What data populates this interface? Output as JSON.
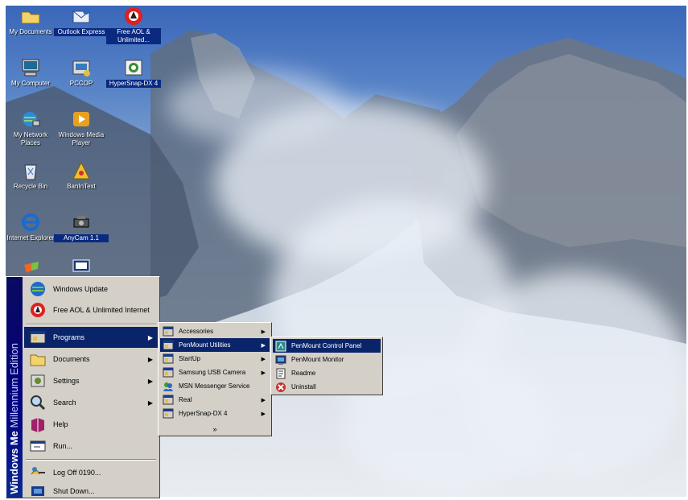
{
  "desktop": {
    "icons": [
      {
        "label": "My Documents",
        "icon": "folder-icon"
      },
      {
        "label": "Outlook Express",
        "icon": "outlook-express-icon"
      },
      {
        "label": "Free AOL & Unlimited...",
        "icon": "aol-icon"
      },
      {
        "label": "My Computer",
        "icon": "computer-icon"
      },
      {
        "label": "PCCOP",
        "icon": "pccop-icon"
      },
      {
        "label": "HyperSnap-DX 4",
        "icon": "hypersnap-icon"
      },
      {
        "label": "My Network Places",
        "icon": "network-icon"
      },
      {
        "label": "Windows Media Player",
        "icon": "media-player-icon"
      },
      {
        "label": "Recycle Bin",
        "icon": "recycle-bin-icon"
      },
      {
        "label": "BanInText",
        "icon": "bantext-icon"
      },
      {
        "label": "Internet Explorer",
        "icon": "internet-explorer-icon"
      },
      {
        "label": "AnyCam 1.1",
        "icon": "camera-icon"
      }
    ]
  },
  "start_menu": {
    "sidebar_bold": "Windows Me",
    "sidebar_light": " Millennium Edition",
    "items": [
      {
        "label": "Windows Update",
        "icon": "windows-update-icon"
      },
      {
        "label": "Free AOL & Unlimited Internet",
        "icon": "aol-icon"
      },
      {
        "label": "Programs",
        "icon": "programs-icon"
      },
      {
        "label": "Documents",
        "icon": "documents-icon"
      },
      {
        "label": "Settings",
        "icon": "settings-icon"
      },
      {
        "label": "Search",
        "icon": "search-icon"
      },
      {
        "label": "Help",
        "icon": "help-icon"
      },
      {
        "label": "Run...",
        "icon": "run-icon"
      },
      {
        "label": "Log Off 0190...",
        "icon": "log-off-icon"
      },
      {
        "label": "Shut Down...",
        "icon": "shut-down-icon"
      }
    ]
  },
  "programs_menu": {
    "items": [
      {
        "label": "Accessories",
        "icon": "program-group-icon"
      },
      {
        "label": "PenMount Utilities",
        "icon": "program-group-icon"
      },
      {
        "label": "StartUp",
        "icon": "program-group-icon"
      },
      {
        "label": "Samsung USB Camera",
        "icon": "program-group-icon"
      },
      {
        "label": "MSN Messenger Service",
        "icon": "msn-icon"
      },
      {
        "label": "Real",
        "icon": "program-group-icon"
      },
      {
        "label": "HyperSnap-DX 4",
        "icon": "program-group-icon"
      }
    ],
    "more": "»"
  },
  "penmount_menu": {
    "items": [
      {
        "label": "PenMount Control Panel",
        "icon": "control-panel-icon"
      },
      {
        "label": "PenMount Monitor",
        "icon": "monitor-icon"
      },
      {
        "label": "Readme",
        "icon": "readme-icon"
      },
      {
        "label": "Uninstall",
        "icon": "uninstall-icon"
      }
    ]
  },
  "colors": {
    "highlight": "#0a246a",
    "menu_face": "#d4d0c8",
    "sidebar": "#000080"
  }
}
